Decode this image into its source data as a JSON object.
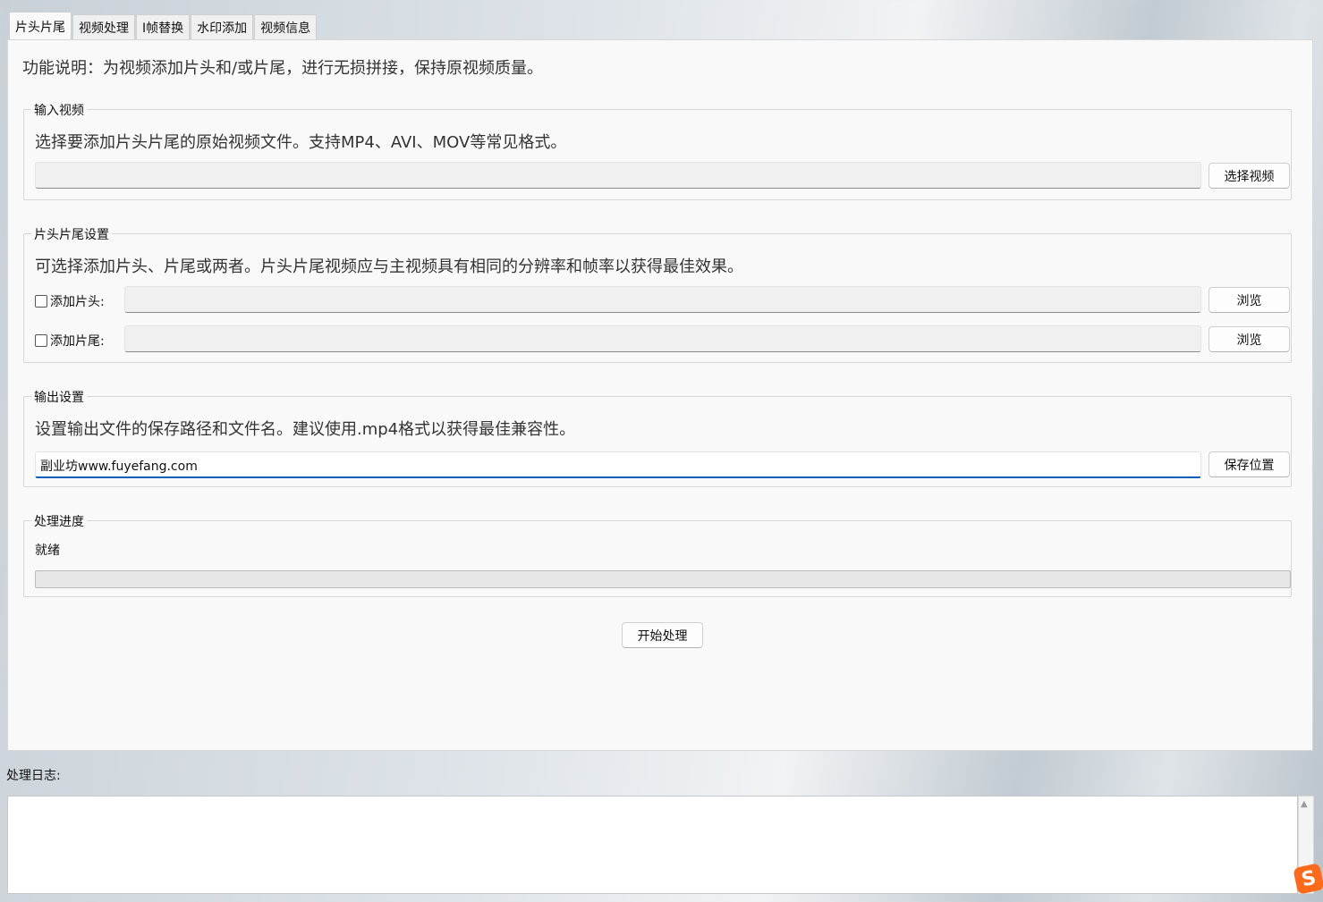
{
  "tabs": [
    "片头片尾",
    "视频处理",
    "I帧替换",
    "水印添加",
    "视频信息"
  ],
  "active_tab": 0,
  "intro": "功能说明：为视频添加片头和/或片尾，进行无损拼接，保持原视频质量。",
  "input_group": {
    "title": "输入视频",
    "desc": "选择要添加片头片尾的原始视频文件。支持MP4、AVI、MOV等常见格式。",
    "path_value": "",
    "button": "选择视频"
  },
  "intro_outro_group": {
    "title": "片头片尾设置",
    "desc": "可选择添加片头、片尾或两者。片头片尾视频应与主视频具有相同的分辨率和帧率以获得最佳效果。",
    "add_intro": {
      "label": "添加片头:",
      "checked": false,
      "path_value": "",
      "button": "浏览"
    },
    "add_outro": {
      "label": "添加片尾:",
      "checked": false,
      "path_value": "",
      "button": "浏览"
    }
  },
  "output_group": {
    "title": "输出设置",
    "desc": "设置输出文件的保存路径和文件名。建议使用.mp4格式以获得最佳兼容性。",
    "path_value": "副业坊www.fuyefang.com",
    "button": "保存位置"
  },
  "progress_group": {
    "title": "处理进度",
    "status": "就绪",
    "progress_percent": 0
  },
  "start_button": "开始处理",
  "log": {
    "label": "处理日志:",
    "content": ""
  },
  "icons": {
    "scroll_up": "triangle-up",
    "tray_ime": "S"
  },
  "colors": {
    "focus_underline": "#005fb8",
    "ime_badge": "#ff6a1a"
  }
}
